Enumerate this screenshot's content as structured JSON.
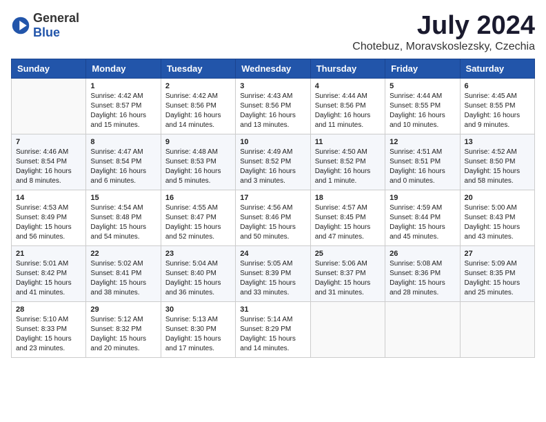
{
  "logo": {
    "general": "General",
    "blue": "Blue"
  },
  "title": "July 2024",
  "subtitle": "Chotebuz, Moravskoslezsky, Czechia",
  "days": [
    "Sunday",
    "Monday",
    "Tuesday",
    "Wednesday",
    "Thursday",
    "Friday",
    "Saturday"
  ],
  "weeks": [
    [
      {
        "day": "",
        "sunrise": "",
        "sunset": "",
        "daylight": ""
      },
      {
        "day": "1",
        "sunrise": "Sunrise: 4:42 AM",
        "sunset": "Sunset: 8:57 PM",
        "daylight": "Daylight: 16 hours and 15 minutes."
      },
      {
        "day": "2",
        "sunrise": "Sunrise: 4:42 AM",
        "sunset": "Sunset: 8:56 PM",
        "daylight": "Daylight: 16 hours and 14 minutes."
      },
      {
        "day": "3",
        "sunrise": "Sunrise: 4:43 AM",
        "sunset": "Sunset: 8:56 PM",
        "daylight": "Daylight: 16 hours and 13 minutes."
      },
      {
        "day": "4",
        "sunrise": "Sunrise: 4:44 AM",
        "sunset": "Sunset: 8:56 PM",
        "daylight": "Daylight: 16 hours and 11 minutes."
      },
      {
        "day": "5",
        "sunrise": "Sunrise: 4:44 AM",
        "sunset": "Sunset: 8:55 PM",
        "daylight": "Daylight: 16 hours and 10 minutes."
      },
      {
        "day": "6",
        "sunrise": "Sunrise: 4:45 AM",
        "sunset": "Sunset: 8:55 PM",
        "daylight": "Daylight: 16 hours and 9 minutes."
      }
    ],
    [
      {
        "day": "7",
        "sunrise": "Sunrise: 4:46 AM",
        "sunset": "Sunset: 8:54 PM",
        "daylight": "Daylight: 16 hours and 8 minutes."
      },
      {
        "day": "8",
        "sunrise": "Sunrise: 4:47 AM",
        "sunset": "Sunset: 8:54 PM",
        "daylight": "Daylight: 16 hours and 6 minutes."
      },
      {
        "day": "9",
        "sunrise": "Sunrise: 4:48 AM",
        "sunset": "Sunset: 8:53 PM",
        "daylight": "Daylight: 16 hours and 5 minutes."
      },
      {
        "day": "10",
        "sunrise": "Sunrise: 4:49 AM",
        "sunset": "Sunset: 8:52 PM",
        "daylight": "Daylight: 16 hours and 3 minutes."
      },
      {
        "day": "11",
        "sunrise": "Sunrise: 4:50 AM",
        "sunset": "Sunset: 8:52 PM",
        "daylight": "Daylight: 16 hours and 1 minute."
      },
      {
        "day": "12",
        "sunrise": "Sunrise: 4:51 AM",
        "sunset": "Sunset: 8:51 PM",
        "daylight": "Daylight: 16 hours and 0 minutes."
      },
      {
        "day": "13",
        "sunrise": "Sunrise: 4:52 AM",
        "sunset": "Sunset: 8:50 PM",
        "daylight": "Daylight: 15 hours and 58 minutes."
      }
    ],
    [
      {
        "day": "14",
        "sunrise": "Sunrise: 4:53 AM",
        "sunset": "Sunset: 8:49 PM",
        "daylight": "Daylight: 15 hours and 56 minutes."
      },
      {
        "day": "15",
        "sunrise": "Sunrise: 4:54 AM",
        "sunset": "Sunset: 8:48 PM",
        "daylight": "Daylight: 15 hours and 54 minutes."
      },
      {
        "day": "16",
        "sunrise": "Sunrise: 4:55 AM",
        "sunset": "Sunset: 8:47 PM",
        "daylight": "Daylight: 15 hours and 52 minutes."
      },
      {
        "day": "17",
        "sunrise": "Sunrise: 4:56 AM",
        "sunset": "Sunset: 8:46 PM",
        "daylight": "Daylight: 15 hours and 50 minutes."
      },
      {
        "day": "18",
        "sunrise": "Sunrise: 4:57 AM",
        "sunset": "Sunset: 8:45 PM",
        "daylight": "Daylight: 15 hours and 47 minutes."
      },
      {
        "day": "19",
        "sunrise": "Sunrise: 4:59 AM",
        "sunset": "Sunset: 8:44 PM",
        "daylight": "Daylight: 15 hours and 45 minutes."
      },
      {
        "day": "20",
        "sunrise": "Sunrise: 5:00 AM",
        "sunset": "Sunset: 8:43 PM",
        "daylight": "Daylight: 15 hours and 43 minutes."
      }
    ],
    [
      {
        "day": "21",
        "sunrise": "Sunrise: 5:01 AM",
        "sunset": "Sunset: 8:42 PM",
        "daylight": "Daylight: 15 hours and 41 minutes."
      },
      {
        "day": "22",
        "sunrise": "Sunrise: 5:02 AM",
        "sunset": "Sunset: 8:41 PM",
        "daylight": "Daylight: 15 hours and 38 minutes."
      },
      {
        "day": "23",
        "sunrise": "Sunrise: 5:04 AM",
        "sunset": "Sunset: 8:40 PM",
        "daylight": "Daylight: 15 hours and 36 minutes."
      },
      {
        "day": "24",
        "sunrise": "Sunrise: 5:05 AM",
        "sunset": "Sunset: 8:39 PM",
        "daylight": "Daylight: 15 hours and 33 minutes."
      },
      {
        "day": "25",
        "sunrise": "Sunrise: 5:06 AM",
        "sunset": "Sunset: 8:37 PM",
        "daylight": "Daylight: 15 hours and 31 minutes."
      },
      {
        "day": "26",
        "sunrise": "Sunrise: 5:08 AM",
        "sunset": "Sunset: 8:36 PM",
        "daylight": "Daylight: 15 hours and 28 minutes."
      },
      {
        "day": "27",
        "sunrise": "Sunrise: 5:09 AM",
        "sunset": "Sunset: 8:35 PM",
        "daylight": "Daylight: 15 hours and 25 minutes."
      }
    ],
    [
      {
        "day": "28",
        "sunrise": "Sunrise: 5:10 AM",
        "sunset": "Sunset: 8:33 PM",
        "daylight": "Daylight: 15 hours and 23 minutes."
      },
      {
        "day": "29",
        "sunrise": "Sunrise: 5:12 AM",
        "sunset": "Sunset: 8:32 PM",
        "daylight": "Daylight: 15 hours and 20 minutes."
      },
      {
        "day": "30",
        "sunrise": "Sunrise: 5:13 AM",
        "sunset": "Sunset: 8:30 PM",
        "daylight": "Daylight: 15 hours and 17 minutes."
      },
      {
        "day": "31",
        "sunrise": "Sunrise: 5:14 AM",
        "sunset": "Sunset: 8:29 PM",
        "daylight": "Daylight: 15 hours and 14 minutes."
      },
      {
        "day": "",
        "sunrise": "",
        "sunset": "",
        "daylight": ""
      },
      {
        "day": "",
        "sunrise": "",
        "sunset": "",
        "daylight": ""
      },
      {
        "day": "",
        "sunrise": "",
        "sunset": "",
        "daylight": ""
      }
    ]
  ]
}
